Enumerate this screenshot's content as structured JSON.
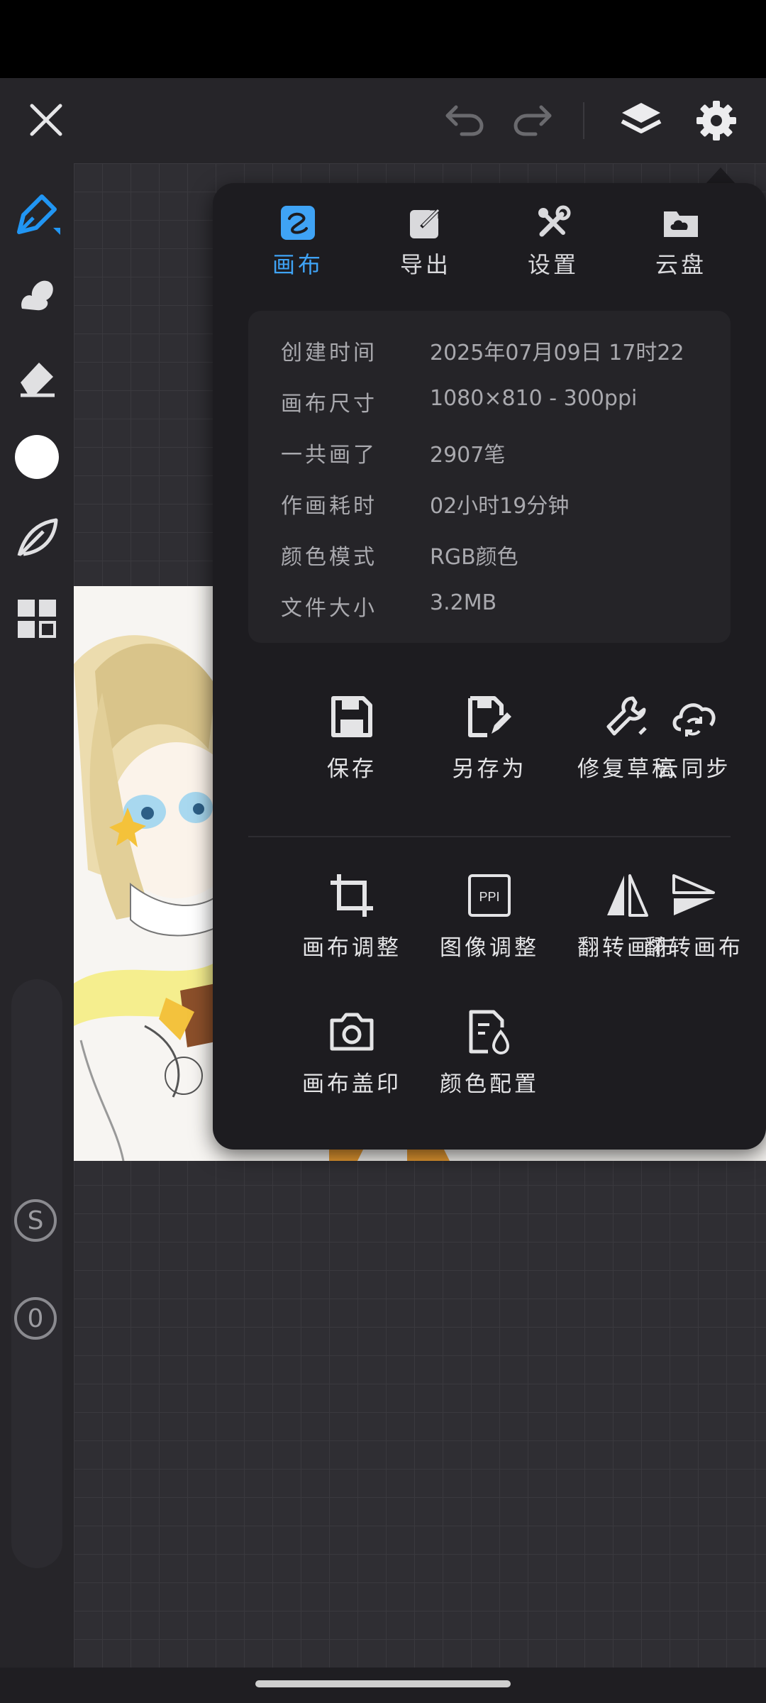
{
  "topbar": {
    "close_icon": "close-icon",
    "undo_icon": "undo-icon",
    "redo_icon": "redo-icon",
    "layers_icon": "layers-icon",
    "settings_icon": "gear-icon"
  },
  "left_toolbar": {
    "tools": [
      "pen-icon",
      "smudge-icon",
      "eraser-icon",
      "color-swatch",
      "leaf-icon",
      "grid-icon"
    ],
    "slider_badges": [
      "S",
      "0"
    ]
  },
  "panel": {
    "tabs": [
      {
        "label": "画布",
        "icon": "canvas-icon",
        "active": true
      },
      {
        "label": "导出",
        "icon": "export-icon",
        "active": false
      },
      {
        "label": "设置",
        "icon": "settings-tools-icon",
        "active": false
      },
      {
        "label": "云盘",
        "icon": "cloud-drive-icon",
        "active": false
      }
    ],
    "info": [
      {
        "key": "创建时间",
        "value": "2025年07月09日 17时22"
      },
      {
        "key": "画布尺寸",
        "value": "1080×810 - 300ppi"
      },
      {
        "key": "一共画了",
        "value": "2907笔"
      },
      {
        "key": "作画耗时",
        "value": "02小时19分钟"
      },
      {
        "key": "颜色模式",
        "value": "RGB颜色"
      },
      {
        "key": "文件大小",
        "value": "3.2MB"
      }
    ],
    "actions_row1": [
      {
        "label": "保存",
        "icon": "save-icon"
      },
      {
        "label": "另存为",
        "icon": "save-as-icon"
      },
      {
        "label": "修复草稿",
        "icon": "wrench-icon"
      },
      {
        "label": "云同步",
        "icon": "cloud-sync-icon"
      }
    ],
    "actions_row2": [
      {
        "label": "画布调整",
        "icon": "crop-icon"
      },
      {
        "label": "图像调整",
        "icon": "ppi-icon",
        "text": "PPI"
      },
      {
        "label": "翻转画布",
        "icon": "flip-horizontal-icon"
      },
      {
        "label": "翻转画布",
        "icon": "flip-vertical-icon"
      }
    ],
    "actions_row3": [
      {
        "label": "画布盖印",
        "icon": "camera-icon"
      },
      {
        "label": "颜色配置",
        "icon": "color-profile-icon"
      }
    ]
  },
  "colors": {
    "accent": "#3fa3f5",
    "panel_bg": "#1d1c20",
    "card_bg": "#252428"
  }
}
